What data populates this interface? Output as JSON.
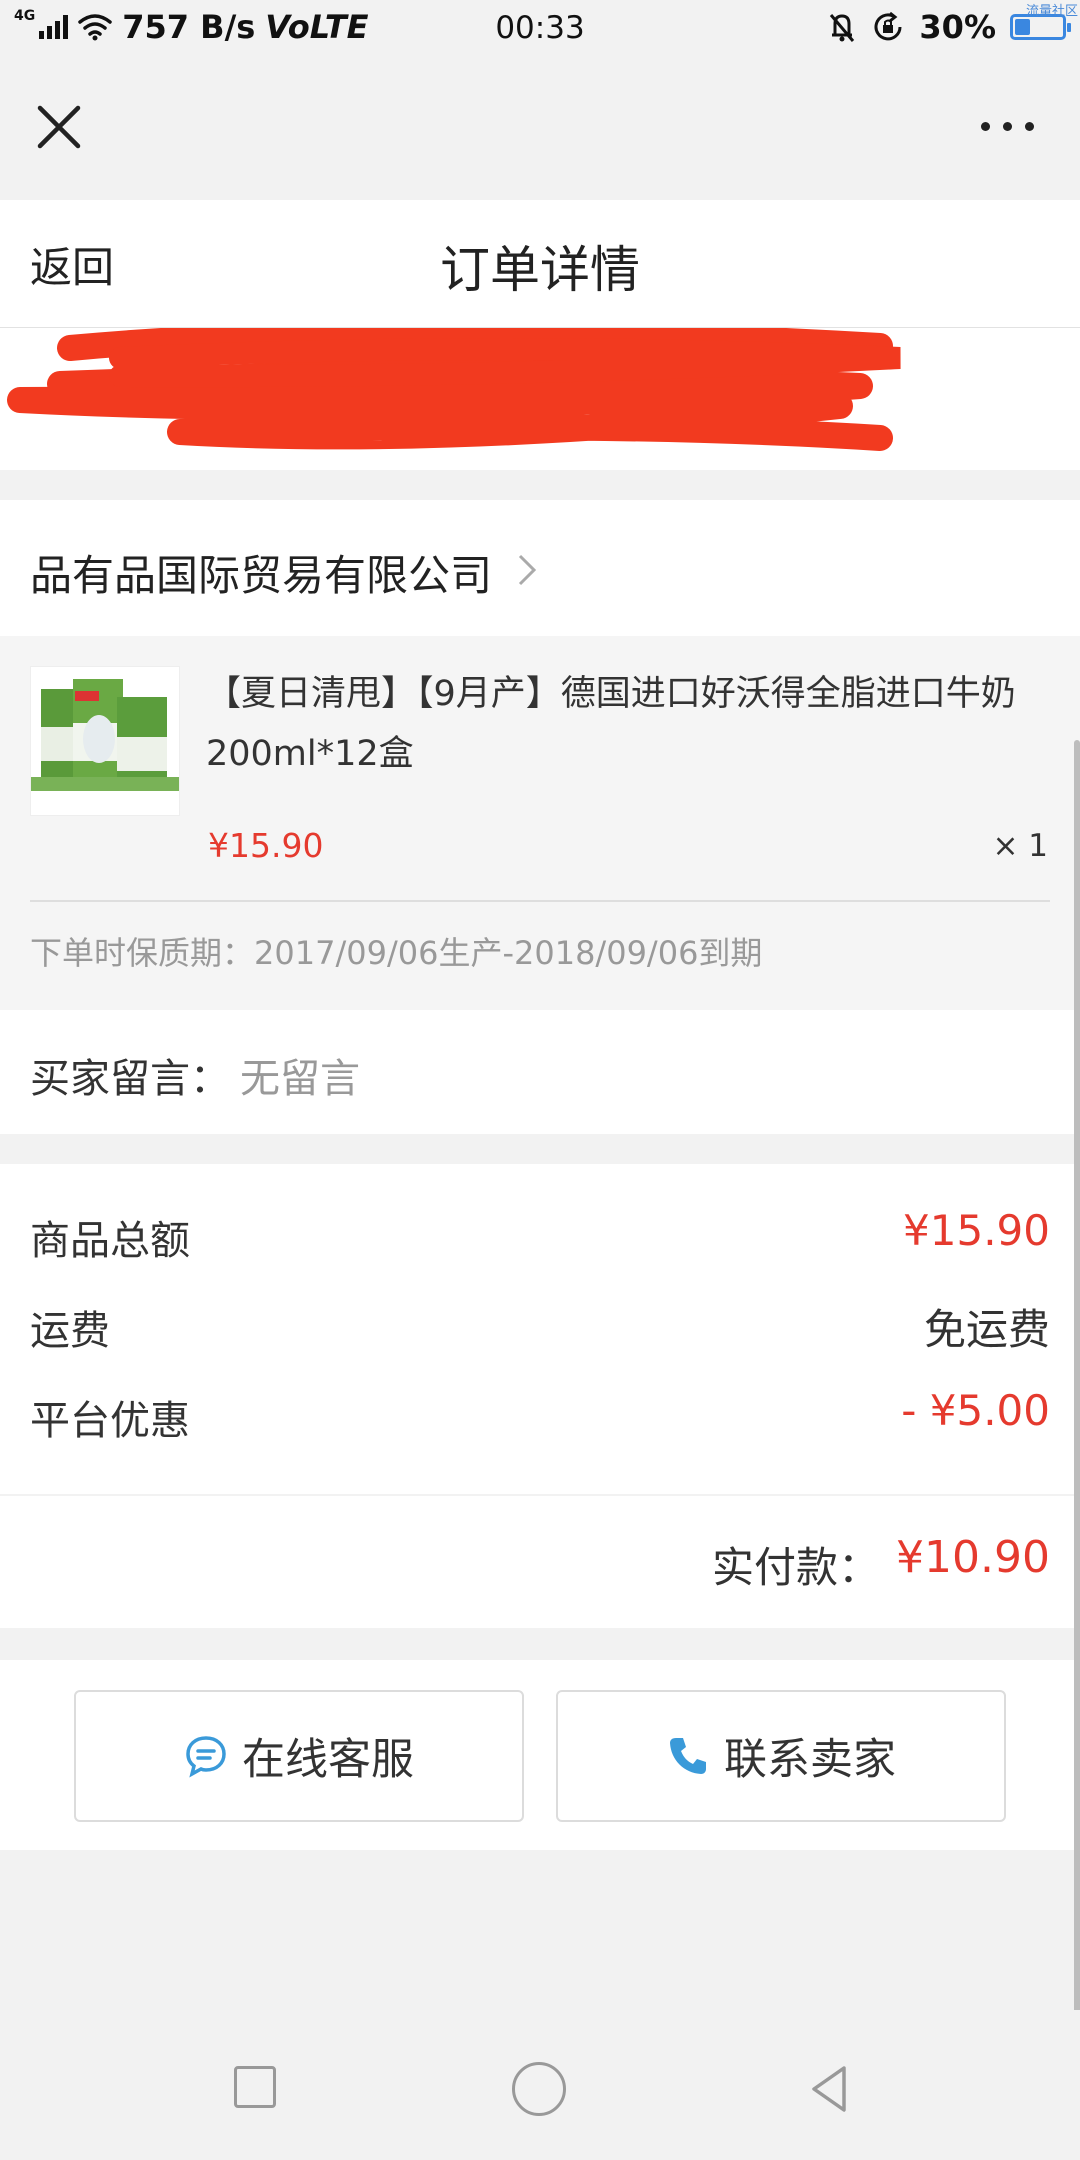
{
  "status_bar": {
    "network": "4G",
    "speed": "757 B/s",
    "volte": "VoLTE",
    "time": "00:33",
    "battery": "30%",
    "battery_level": 0.3,
    "watermark": "流量社区"
  },
  "header": {
    "back_label": "返回",
    "title": "订单详情"
  },
  "shop": {
    "name": "品有品国际贸易有限公司"
  },
  "product": {
    "title": "【夏日清甩】【9月产】德国进口好沃得全脂进口牛奶200ml*12盒",
    "price": "¥15.90",
    "quantity": "× 1",
    "shelf_life": "下单时保质期：2017/09/06生产-2018/09/06到期"
  },
  "message": {
    "label": "买家留言：",
    "value": "无留言"
  },
  "summary": {
    "goods_total_label": "商品总额",
    "goods_total_value": "¥15.90",
    "shipping_label": "运费",
    "shipping_value": "免运费",
    "discount_label": "平台优惠",
    "discount_value": "- ¥5.00"
  },
  "total": {
    "label": "实付款：",
    "value": "¥10.90"
  },
  "actions": {
    "service_label": "在线客服",
    "seller_label": "联系卖家"
  },
  "colors": {
    "price_red": "#e53a2e",
    "accent_blue": "#3a9ad9"
  }
}
